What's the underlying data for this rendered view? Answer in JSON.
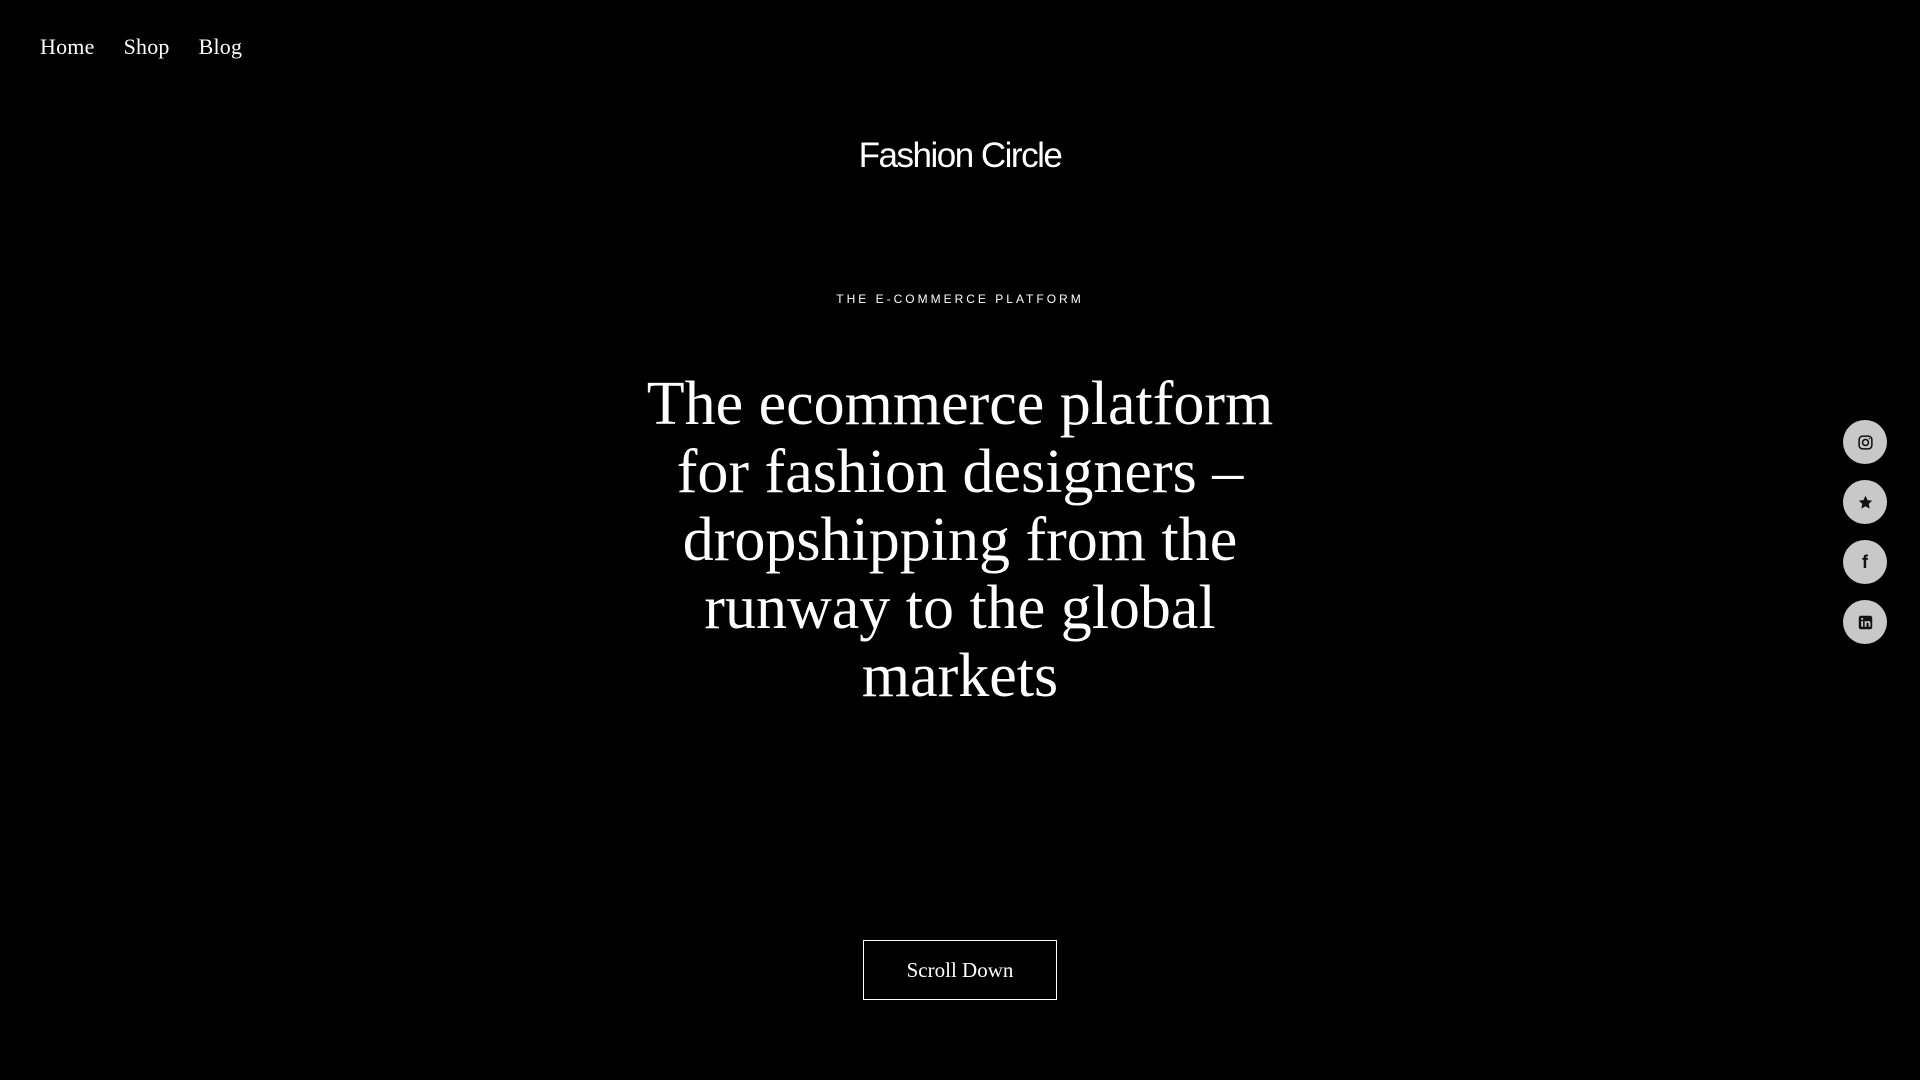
{
  "nav": {
    "items": [
      {
        "label": "Home"
      },
      {
        "label": "Shop"
      },
      {
        "label": "Blog"
      }
    ]
  },
  "brand": {
    "name": "Fashion Circle"
  },
  "hero": {
    "eyebrow": "THE E-COMMERCE PLATFORM",
    "headline": "The ecommerce platform for fashion designers – dropshipping from the runway to the global markets",
    "cta_label": "Scroll Down"
  },
  "social": {
    "icons": [
      "instagram-icon",
      "star-icon",
      "facebook-icon",
      "linkedin-icon"
    ],
    "facebook_glyph": "f"
  },
  "colors": {
    "background": "#000000",
    "text": "#ffffff",
    "social_bg": "#c8c8c8",
    "social_icon": "#111111"
  }
}
